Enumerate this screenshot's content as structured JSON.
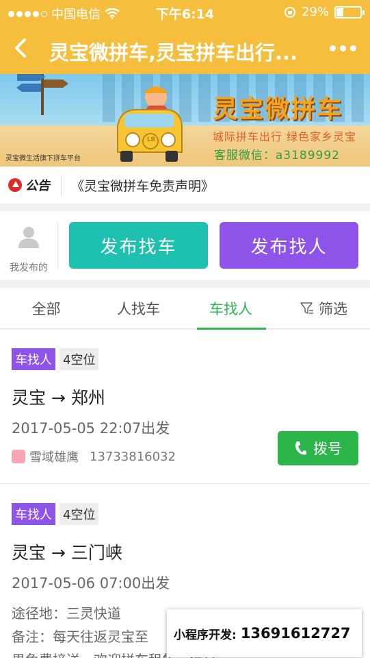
{
  "status_bar": {
    "carrier": "中国电信",
    "time": "下午6:14",
    "battery": "29%",
    "battery_level": 0.29
  },
  "nav": {
    "title": "灵宝微拼车,灵宝拼车出行..."
  },
  "banner": {
    "brand": "灵宝微拼车",
    "slogan": "城际拼车出行 绿色家乡灵宝",
    "wechat": "客服微信：a3189992",
    "platform": "灵宝微生活旗下拼车平台",
    "car_badge": "LB"
  },
  "notice": {
    "badge": "公告",
    "text": "《灵宝微拼车免责声明》"
  },
  "actions": {
    "mine_label": "我发布的",
    "find_car": "发布找车",
    "find_people": "发布找人"
  },
  "tabs": [
    {
      "label": "全部"
    },
    {
      "label": "人找车"
    },
    {
      "label": "车找人",
      "active": true
    },
    {
      "label": "筛选"
    }
  ],
  "listings": [
    {
      "type": "车找人",
      "seats": "4空位",
      "route": "灵宝 → 郑州",
      "depart": "2017-05-05 22:07出发",
      "user": "雪域雄鹰",
      "phone": "13733816032",
      "dial_label": "拨号"
    },
    {
      "type": "车找人",
      "seats": "4空位",
      "route": "灵宝 → 三门峡",
      "depart": "2017-05-06 07:00出发",
      "via": "途径地：三灵快道",
      "note": "备注：每天往返灵宝至",
      "note_cont": "男免费接送，欢迎拼车租售，信息"
    }
  ],
  "dev_banner": {
    "label": "小程序开发:",
    "phone": "13691612727"
  },
  "colors": {
    "accent": "#f5be3c",
    "teal": "#1ec0b0",
    "purple": "#8e54e9",
    "green": "#2cb54b"
  }
}
